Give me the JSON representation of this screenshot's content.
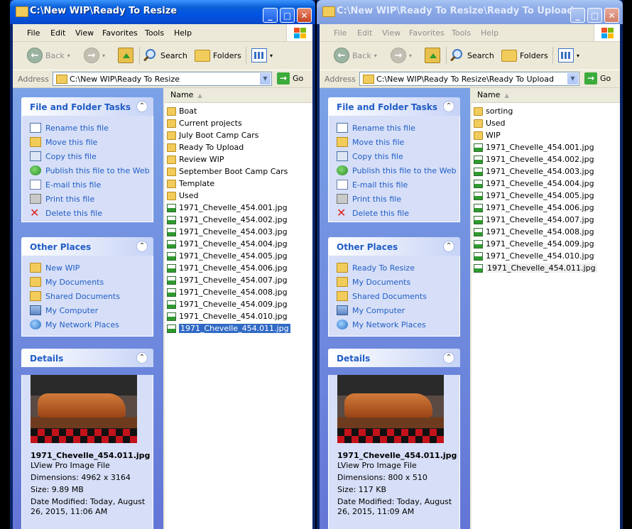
{
  "left": {
    "title": "C:\\New WIP\\Ready To Resize",
    "menu": [
      "File",
      "Edit",
      "View",
      "Favorites",
      "Tools",
      "Help"
    ],
    "toolbar": {
      "back": "Back",
      "search": "Search",
      "folders": "Folders"
    },
    "address": {
      "label": "Address",
      "value": "C:\\New WIP\\Ready To Resize",
      "go": "Go"
    },
    "tasks": {
      "title": "File and Folder Tasks",
      "items": [
        "Rename this file",
        "Move this file",
        "Copy this file",
        "Publish this file to the Web",
        "E-mail this file",
        "Print this file",
        "Delete this file"
      ]
    },
    "places": {
      "title": "Other Places",
      "items": [
        "New WIP",
        "My Documents",
        "Shared Documents",
        "My Computer",
        "My Network Places"
      ]
    },
    "details": {
      "title": "Details",
      "name": "1971_Chevelle_454.011.jpg",
      "type": "LView Pro Image File",
      "dimensions": "Dimensions: 4962 x 3164",
      "size": "Size: 9.89 MB",
      "modified": "Date Modified: Today, August 26, 2015, 11:06 AM"
    },
    "column": "Name",
    "folders": [
      "Boat",
      "Current projects",
      "July Boot Camp Cars",
      "Ready To Upload",
      "Review WIP",
      "September Boot Camp Cars",
      "Template",
      "Used"
    ],
    "files": [
      "1971_Chevelle_454.001.jpg",
      "1971_Chevelle_454.002.jpg",
      "1971_Chevelle_454.003.jpg",
      "1971_Chevelle_454.004.jpg",
      "1971_Chevelle_454.005.jpg",
      "1971_Chevelle_454.006.jpg",
      "1971_Chevelle_454.007.jpg",
      "1971_Chevelle_454.008.jpg",
      "1971_Chevelle_454.009.jpg",
      "1971_Chevelle_454.010.jpg",
      "1971_Chevelle_454.011.jpg"
    ]
  },
  "right": {
    "title": "C:\\New WIP\\Ready To Resize\\Ready To Upload",
    "menu": [
      "File",
      "Edit",
      "View",
      "Favorites",
      "Tools",
      "Help"
    ],
    "toolbar": {
      "back": "Back",
      "search": "Search",
      "folders": "Folders"
    },
    "address": {
      "label": "Address",
      "value": "C:\\New WIP\\Ready To Resize\\Ready To Upload",
      "go": "Go"
    },
    "tasks": {
      "title": "File and Folder Tasks",
      "items": [
        "Rename this file",
        "Move this file",
        "Copy this file",
        "Publish this file to the Web",
        "E-mail this file",
        "Print this file",
        "Delete this file"
      ]
    },
    "places": {
      "title": "Other Places",
      "items": [
        "Ready To Resize",
        "My Documents",
        "Shared Documents",
        "My Computer",
        "My Network Places"
      ]
    },
    "details": {
      "title": "Details",
      "name": "1971_Chevelle_454.011.jpg",
      "type": "LView Pro Image File",
      "dimensions": "Dimensions: 800 x 510",
      "size": "Size: 117 KB",
      "modified": "Date Modified: Today, August 26, 2015, 11:09 AM"
    },
    "column": "Name",
    "folders": [
      "sorting",
      "Used",
      "WIP"
    ],
    "files": [
      "1971_Chevelle_454.001.jpg",
      "1971_Chevelle_454.002.jpg",
      "1971_Chevelle_454.003.jpg",
      "1971_Chevelle_454.004.jpg",
      "1971_Chevelle_454.005.jpg",
      "1971_Chevelle_454.006.jpg",
      "1971_Chevelle_454.007.jpg",
      "1971_Chevelle_454.008.jpg",
      "1971_Chevelle_454.009.jpg",
      "1971_Chevelle_454.010.jpg",
      "1971_Chevelle_454.011.jpg"
    ]
  }
}
